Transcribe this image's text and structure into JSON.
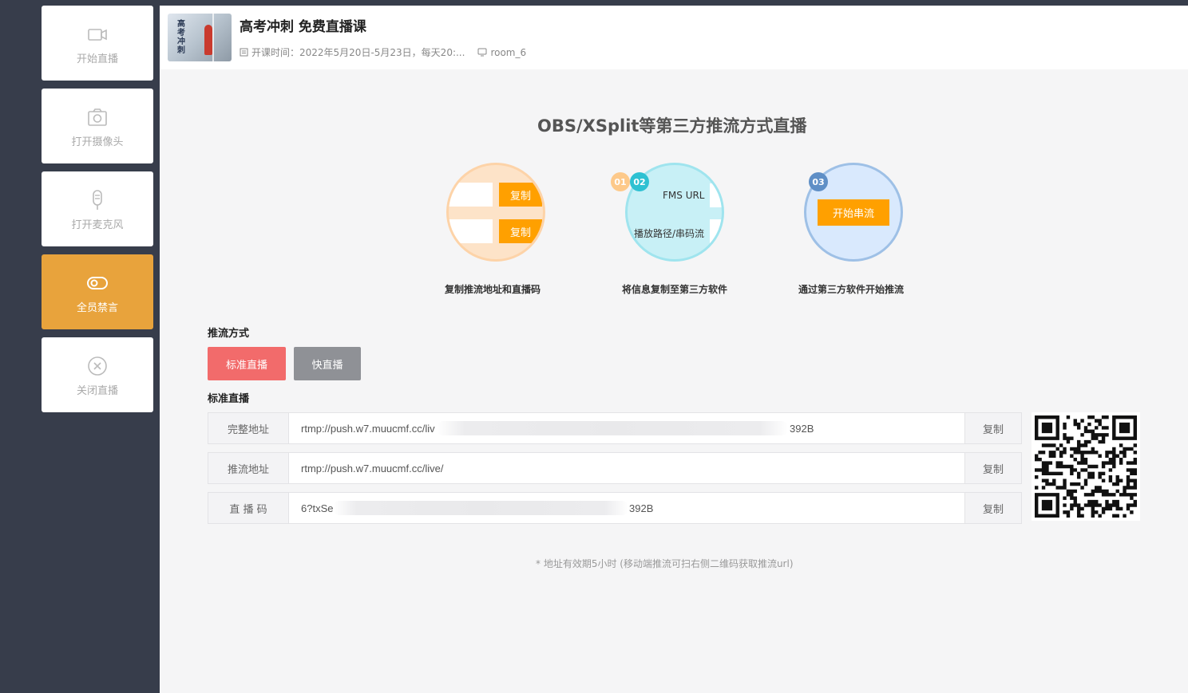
{
  "sidebar": {
    "items": [
      {
        "label": "开始直播",
        "icon": "video-camera-icon",
        "active": false
      },
      {
        "label": "打开摄像头",
        "icon": "camera-icon",
        "active": false
      },
      {
        "label": "打开麦克风",
        "icon": "microphone-icon",
        "active": false
      },
      {
        "label": "全员禁言",
        "icon": "toggle-icon",
        "active": true
      },
      {
        "label": "关闭直播",
        "icon": "close-circle-icon",
        "active": false
      }
    ]
  },
  "header": {
    "thumb_text": "高考冲刺",
    "title": "高考冲刺 免费直播课",
    "schedule": "开课时间：2022年5月20日-5月23日，每天20:...",
    "room": "room_6"
  },
  "main": {
    "title": "OBS/XSplit等第三方推流方式直播",
    "steps": [
      {
        "num": "01",
        "caption": "复制推流地址和直播码",
        "btn1": "复制",
        "btn2": "复制"
      },
      {
        "num": "02",
        "caption": "将信息复制至第三方软件",
        "line1": "FMS URL",
        "line2": "播放路径/串码流"
      },
      {
        "num": "03",
        "caption": "通过第三方软件开始推流",
        "btn": "开始串流"
      }
    ],
    "mode_label": "推流方式",
    "modes": [
      "标准直播",
      "快直播"
    ],
    "std_label": "标准直播",
    "rows": [
      {
        "label": "完整地址",
        "value_prefix": "rtmp://push.w7.muucmf.cc/liv",
        "value_suffix": "392B",
        "copy": "复制"
      },
      {
        "label": "推流地址",
        "value_prefix": "rtmp://push.w7.muucmf.cc/live/",
        "value_suffix": "",
        "copy": "复制"
      },
      {
        "label": "直 播 码",
        "value_prefix": "6?txSe",
        "value_suffix": "392B",
        "copy": "复制"
      }
    ],
    "note": "* 地址有效期5小时 (移动端推流可扫右侧二维码获取推流url)"
  },
  "colors": {
    "sidebar_bg": "#373d4b",
    "active_orange": "#e8a33c",
    "copy_orange": "#ffa000",
    "std_red": "#f26b6b",
    "fast_gray": "#8f9196"
  }
}
